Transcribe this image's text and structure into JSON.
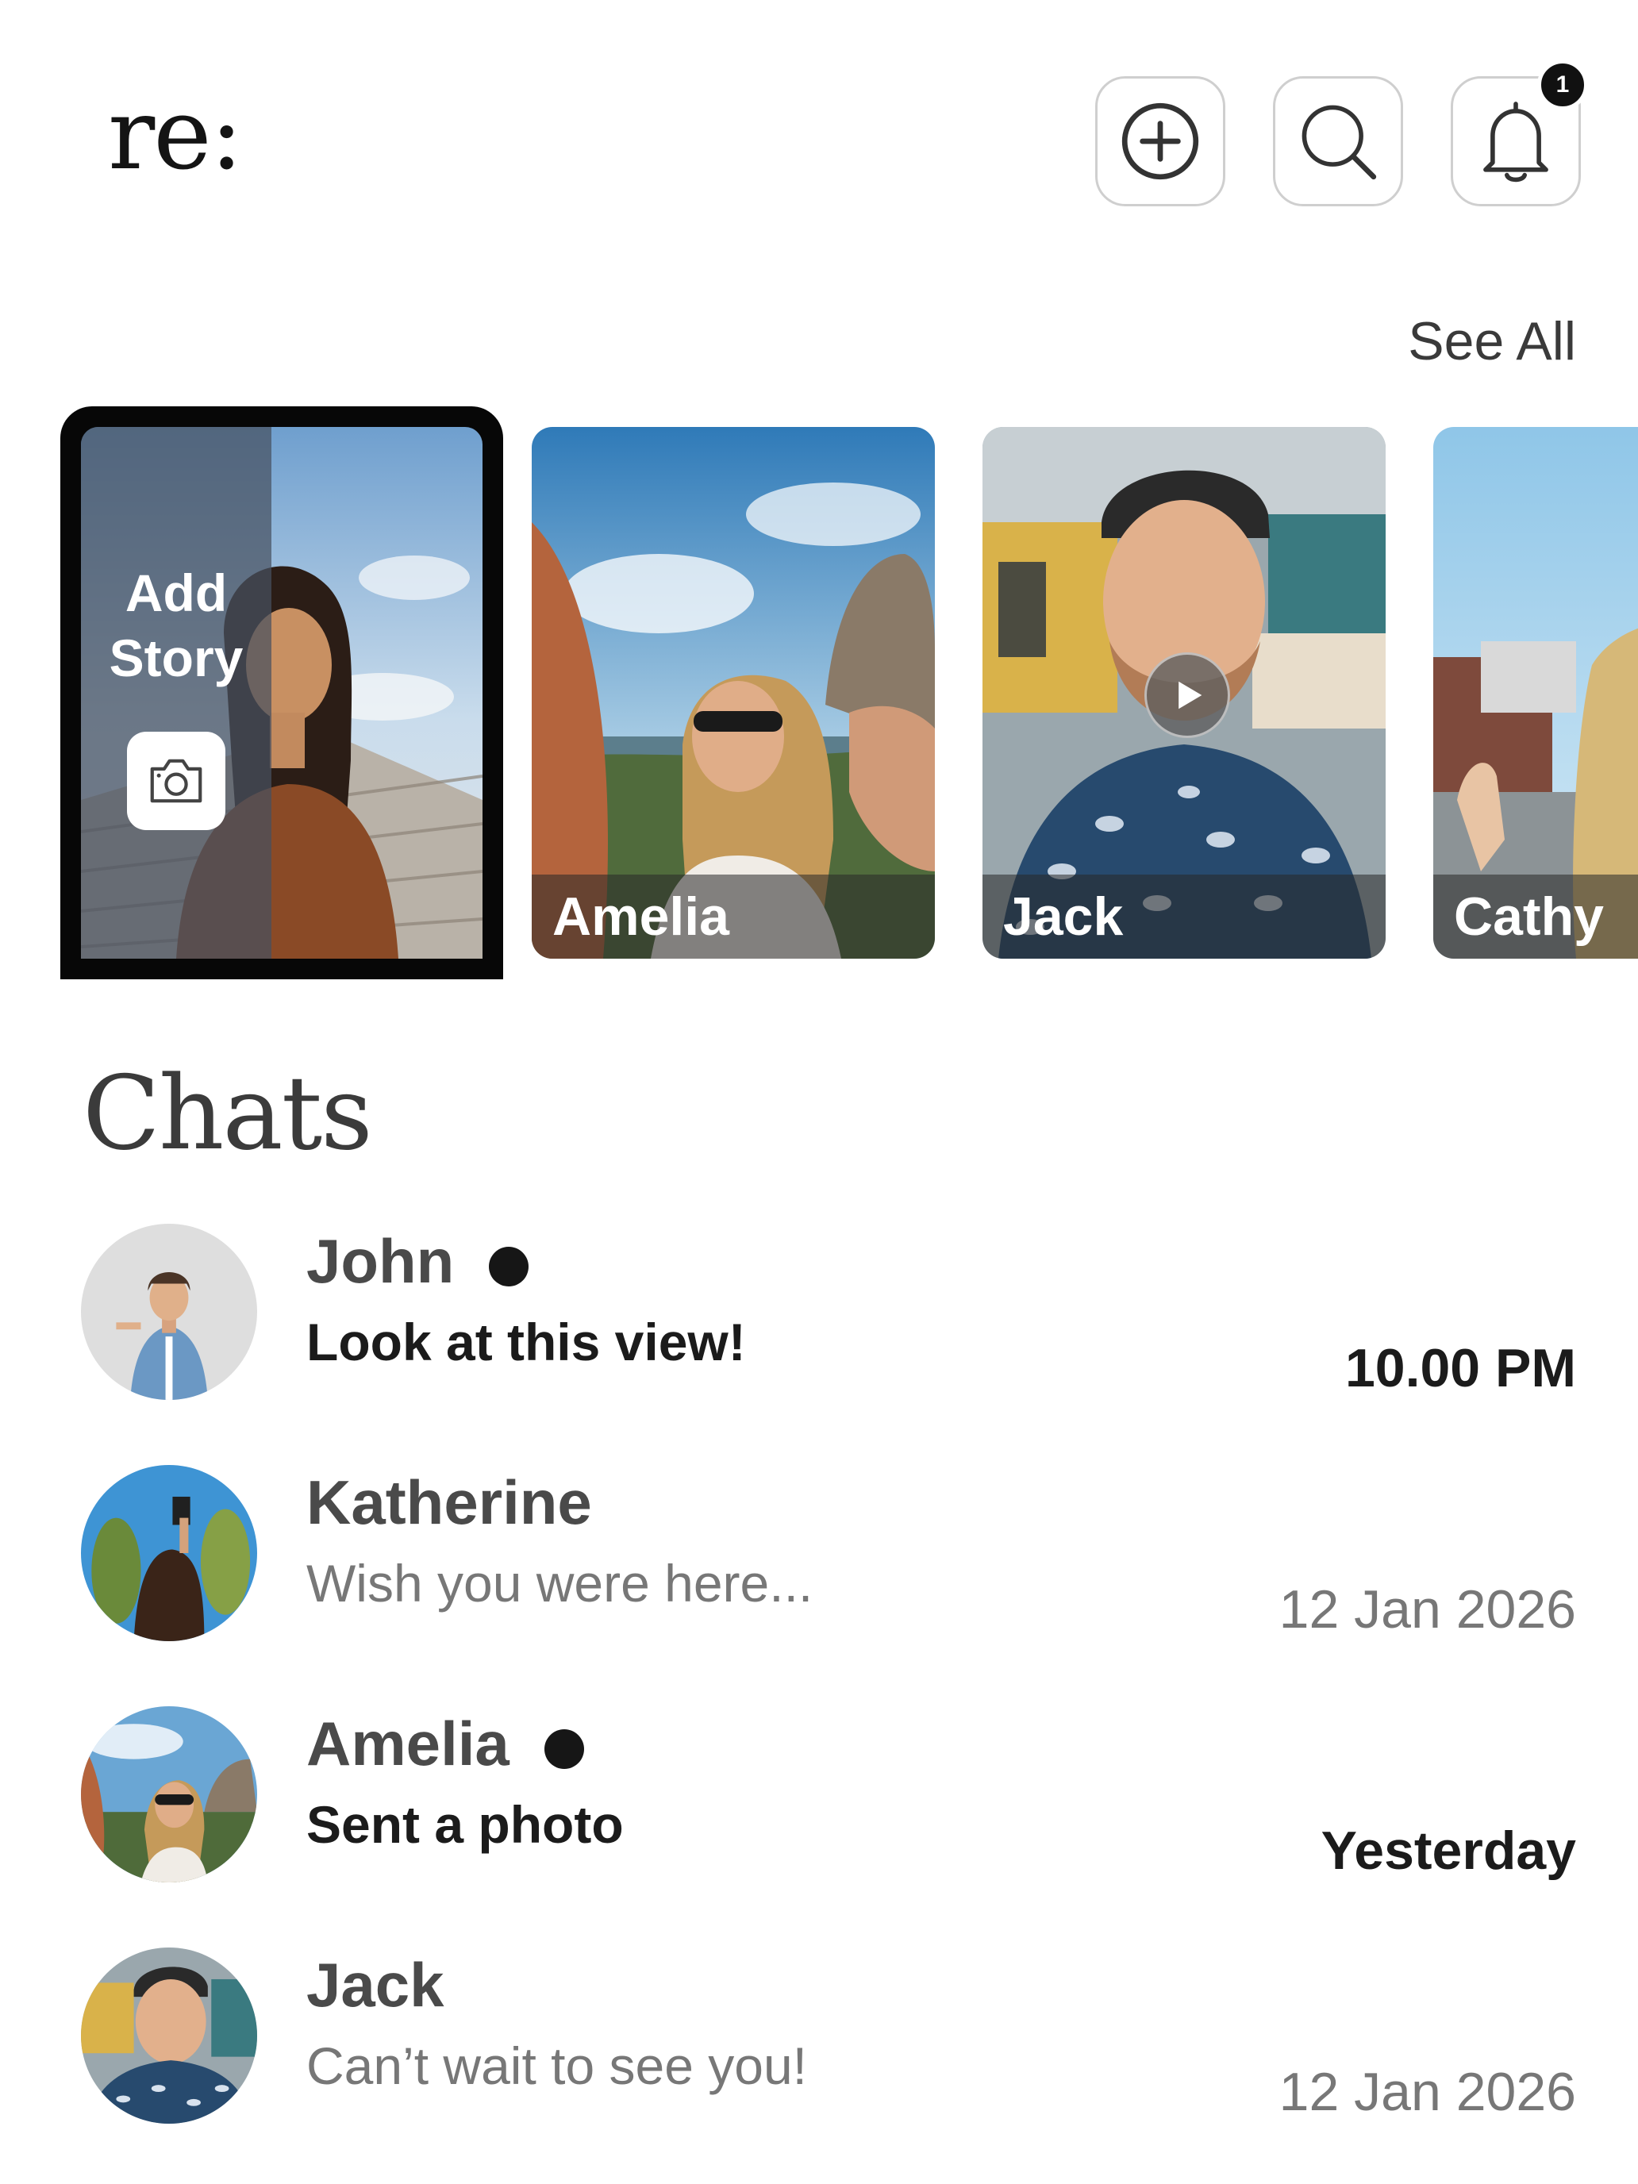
{
  "header": {
    "logo": "re:",
    "notification_count": "1"
  },
  "stories": {
    "see_all": "See All",
    "add_story_line1": "Add",
    "add_story_line2": "Story",
    "items": [
      {
        "name": "Amelia"
      },
      {
        "name": "Jack"
      },
      {
        "name": "Cathy"
      }
    ]
  },
  "chats": {
    "title": "Chats",
    "items": [
      {
        "name": "John",
        "message": "Look at this view!",
        "time": "10.00 PM",
        "unread": true
      },
      {
        "name": "Katherine",
        "message": "Wish you were here...",
        "time": "12 Jan 2026",
        "unread": false
      },
      {
        "name": "Amelia",
        "message": "Sent a photo",
        "time": "Yesterday",
        "unread": true
      },
      {
        "name": "Jack",
        "message": "Can’t wait to see you!",
        "time": "12 Jan 2026",
        "unread": false
      }
    ]
  }
}
